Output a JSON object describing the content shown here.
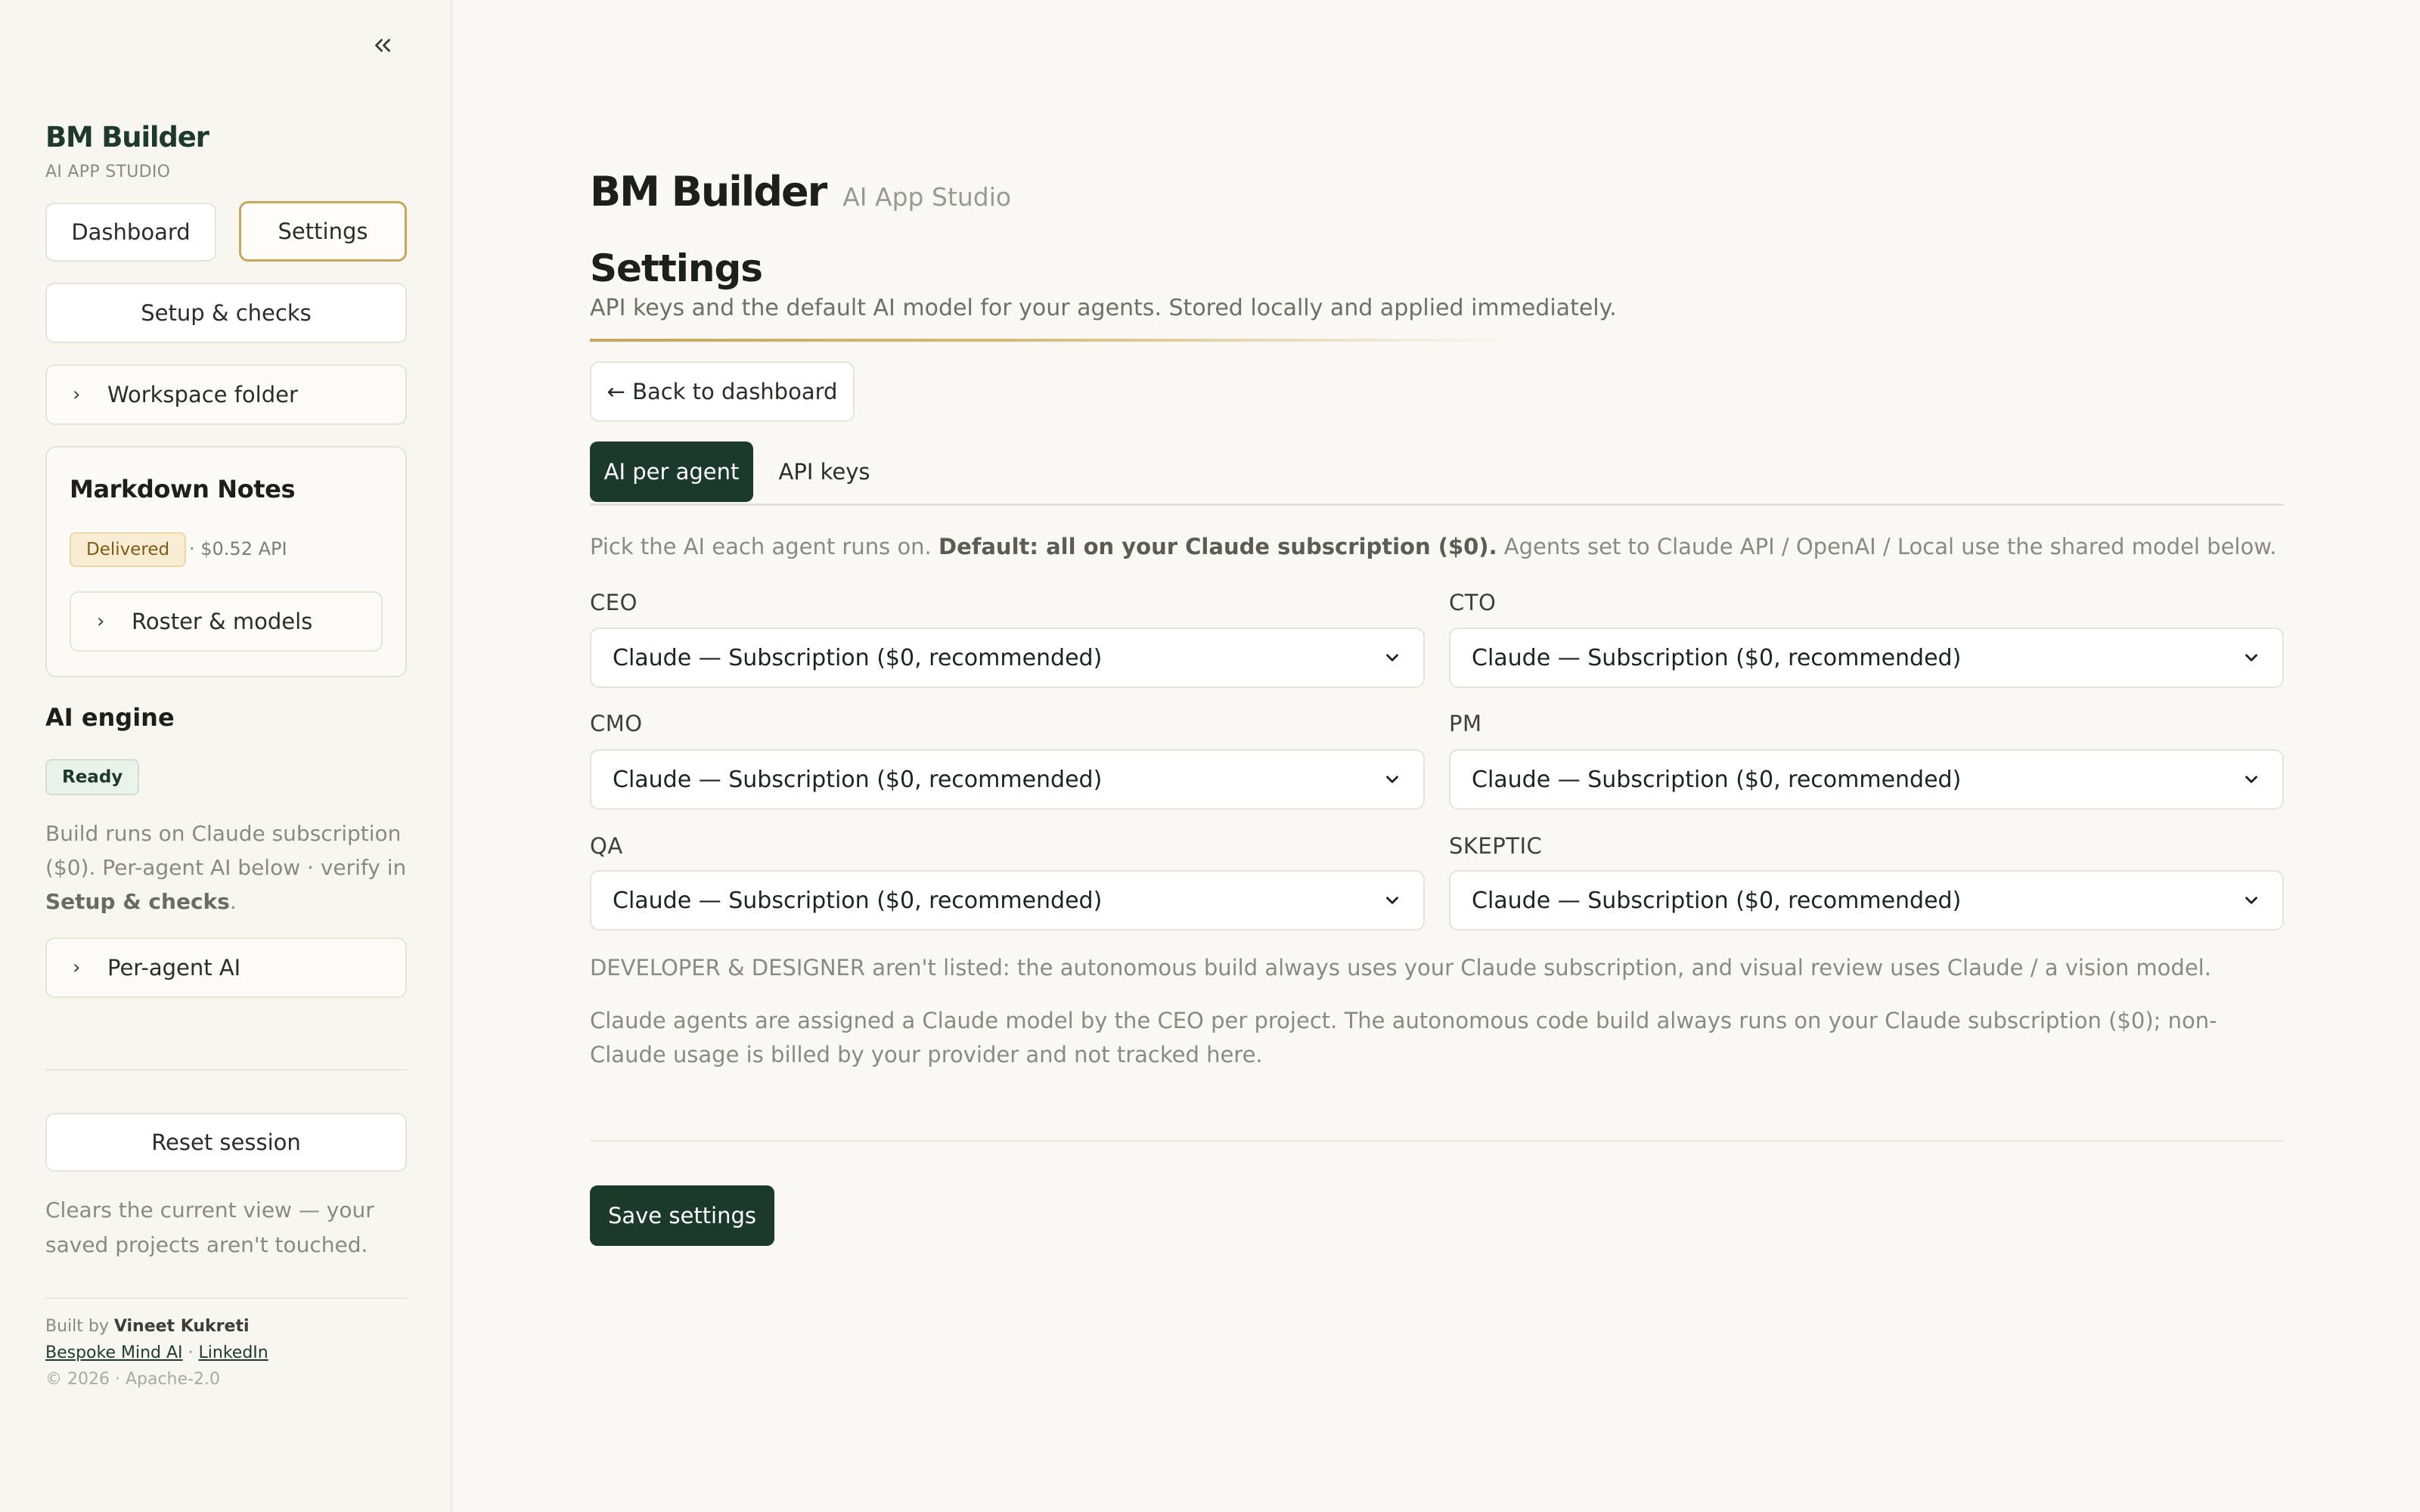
{
  "sidebar": {
    "collapse_icon": "double-chevron-left-icon",
    "brand_title": "BM Builder",
    "brand_subtitle": "AI APP STUDIO",
    "nav": {
      "dashboard": "Dashboard",
      "settings": "Settings",
      "setup_checks": "Setup & checks",
      "workspace_folder": "Workspace folder"
    },
    "project": {
      "name": "Markdown Notes",
      "status": "Delivered",
      "cost": "· $0.52 API",
      "roster_button": "Roster & models"
    },
    "engine": {
      "title": "AI engine",
      "status": "Ready",
      "desc_prefix": "Build runs on Claude subscription ($0). Per-agent AI below · verify in ",
      "desc_link": "Setup & checks",
      "desc_suffix": ".",
      "per_agent_button": "Per-agent AI"
    },
    "reset": {
      "button": "Reset session",
      "desc": "Clears the current view — your saved projects aren't touched."
    },
    "credit": {
      "built_by": "Built by ",
      "author": "Vineet Kukreti",
      "link1": "Bespoke Mind AI",
      "sep": " · ",
      "link2": "LinkedIn",
      "copyright": "© 2026 · Apache-2.0"
    }
  },
  "main": {
    "brand_title": "BM Builder",
    "brand_subtitle": "AI App Studio",
    "page_title": "Settings",
    "page_subtitle": "API keys and the default AI model for your agents. Stored locally and applied immediately.",
    "back_button": "← Back to dashboard",
    "tabs": [
      {
        "label": "AI per agent",
        "active": true
      },
      {
        "label": "API keys",
        "active": false
      }
    ],
    "pick_prefix": "Pick the AI each agent runs on. ",
    "pick_bold": "Default: all on your Claude subscription ($0).",
    "pick_suffix": " Agents set to Claude API / OpenAI / Local use the shared model below.",
    "agents": [
      {
        "role": "CEO",
        "value": "Claude — Subscription ($0, recommended)"
      },
      {
        "role": "CTO",
        "value": "Claude — Subscription ($0, recommended)"
      },
      {
        "role": "CMO",
        "value": "Claude — Subscription ($0, recommended)"
      },
      {
        "role": "PM",
        "value": "Claude — Subscription ($0, recommended)"
      },
      {
        "role": "QA",
        "value": "Claude — Subscription ($0, recommended)"
      },
      {
        "role": "SKEPTIC",
        "value": "Claude — Subscription ($0, recommended)"
      }
    ],
    "note1": "DEVELOPER & DESIGNER aren't listed: the autonomous build always uses your Claude subscription, and visual review uses Claude / a vision model.",
    "note2": "Claude agents are assigned a Claude model by the CEO per project. The autonomous code build always runs on your Claude subscription ($0); non-Claude usage is billed by your provider and not tracked here.",
    "save_button": "Save settings"
  },
  "colors": {
    "accent_dark_green": "#1b3a2c",
    "accent_gold": "#c9a75a",
    "background": "#f9f8f4"
  }
}
